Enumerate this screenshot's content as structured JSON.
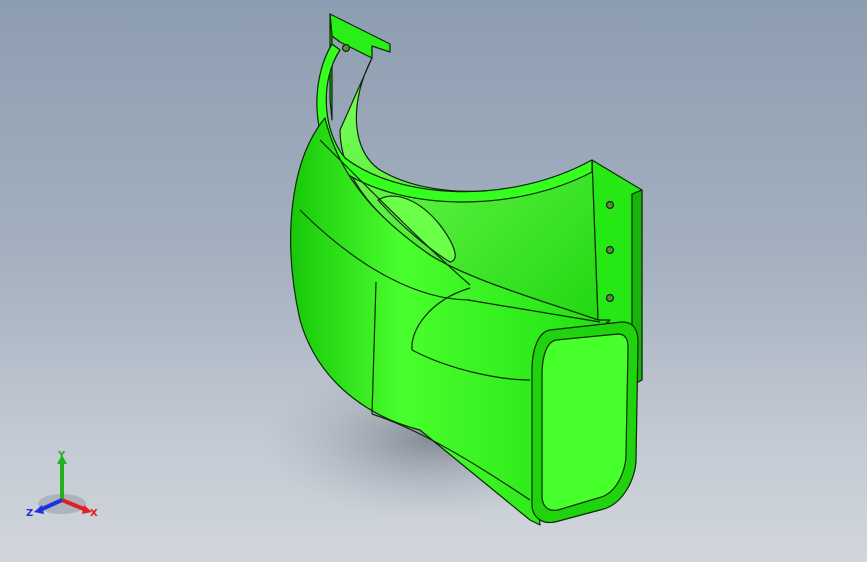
{
  "viewport": {
    "background_top": "#8d9db1",
    "background_bottom": "#d2d6dc"
  },
  "model": {
    "part_color": "#22ee11",
    "edge_color": "#0a2a05"
  },
  "triad": {
    "x_label": "X",
    "y_label": "Y",
    "z_label": "Z",
    "x_color": "#e02020",
    "y_color": "#20b020",
    "z_color": "#2030e0"
  }
}
